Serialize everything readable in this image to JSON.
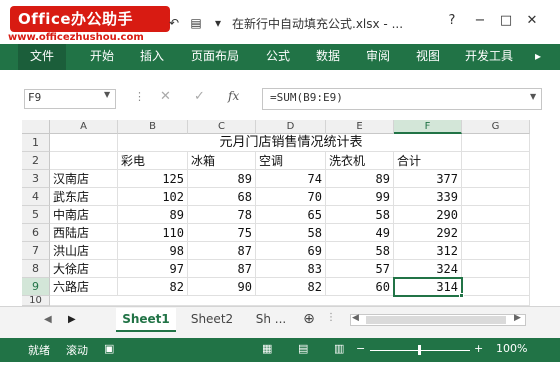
{
  "title_bar": {
    "logo": "Office办公助手",
    "logo_url": "www.officezhushou.com",
    "filename": "在新行中自动填充公式.xlsx - ...",
    "help": "?",
    "minimize": "−",
    "restore": "□",
    "close": "✕"
  },
  "ribbon": {
    "tabs": [
      "文件",
      "开始",
      "插入",
      "页面布局",
      "公式",
      "数据",
      "审阅",
      "视图",
      "开发工具"
    ],
    "more": "▸"
  },
  "formula_bar": {
    "name_box": "F9",
    "formula": "=SUM(B9:E9)",
    "fx": "fx",
    "cancel": "✕",
    "enter": "✓"
  },
  "sheet": {
    "columns": [
      "A",
      "B",
      "C",
      "D",
      "E",
      "F",
      "G"
    ],
    "rows": [
      "1",
      "2",
      "3",
      "4",
      "5",
      "6",
      "7",
      "8",
      "9",
      "10"
    ],
    "title": "元月门店销售情况统计表",
    "headers": [
      "",
      "彩电",
      "冰箱",
      "空调",
      "洗衣机",
      "合计"
    ],
    "data": [
      [
        "汉南店",
        "125",
        "89",
        "74",
        "89",
        "377"
      ],
      [
        "武东店",
        "102",
        "68",
        "70",
        "99",
        "339"
      ],
      [
        "中南店",
        "89",
        "78",
        "65",
        "58",
        "290"
      ],
      [
        "西陆店",
        "110",
        "75",
        "58",
        "49",
        "292"
      ],
      [
        "洪山店",
        "98",
        "87",
        "69",
        "58",
        "312"
      ],
      [
        "大徐店",
        "97",
        "87",
        "83",
        "57",
        "324"
      ],
      [
        "六路店",
        "82",
        "90",
        "82",
        "60",
        "314"
      ]
    ],
    "selected_cell": "F9"
  },
  "sheet_tabs": {
    "tabs": [
      "Sheet1",
      "Sheet2",
      "Sh ..."
    ],
    "add": "⊕"
  },
  "status_bar": {
    "ready": "就绪",
    "scroll": "滚动",
    "minus": "−",
    "plus": "+",
    "zoom": "100%"
  }
}
